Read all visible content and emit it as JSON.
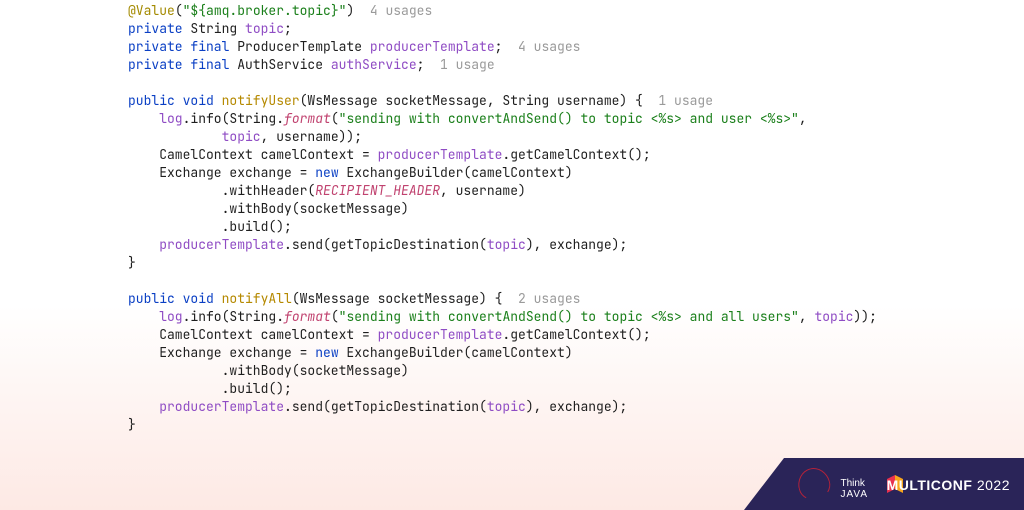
{
  "code": {
    "l1": {
      "ann": "@Value",
      "paren_open": "(",
      "str": "\"${amq.broker.topic}\"",
      "paren_close": ")",
      "hint": "  4 usages"
    },
    "l2": {
      "kw": "private",
      "type": " String ",
      "fld": "topic",
      "semi": ";"
    },
    "l3": {
      "kw": "private final",
      "type": " ProducerTemplate ",
      "fld": "producerTemplate",
      "semi": ";",
      "hint": "  4 usages"
    },
    "l4": {
      "kw": "private final",
      "type": " AuthService ",
      "fld": "authService",
      "semi": ";",
      "hint": "  1 usage"
    },
    "l6": {
      "kw": "public void ",
      "mth": "notifyUser",
      "sig": "(WsMessage socketMessage, String username) {",
      "hint": "  1 usage"
    },
    "l7": {
      "indent": "    ",
      "fld": "log",
      "txt1": ".info(String.",
      "sta": "format",
      "txt2": "(",
      "str": "\"sending with convertAndSend() to topic <%s> and user <%s>\"",
      "txt3": ","
    },
    "l8": {
      "indent": "            ",
      "fld1": "topic",
      "txt1": ", username));"
    },
    "l9": {
      "indent": "    ",
      "txt1": "CamelContext camelContext = ",
      "fld": "producerTemplate",
      "txt2": ".getCamelContext();"
    },
    "l10": {
      "indent": "    ",
      "txt1": "Exchange exchange = ",
      "kw": "new",
      "txt2": " ExchangeBuilder(camelContext)"
    },
    "l11": {
      "indent": "            ",
      "txt1": ".withHeader(",
      "sta": "RECIPIENT_HEADER",
      "txt2": ", username)"
    },
    "l12": {
      "indent": "            ",
      "txt1": ".withBody(socketMessage)"
    },
    "l13": {
      "indent": "            ",
      "txt1": ".build();"
    },
    "l14": {
      "indent": "    ",
      "fld": "producerTemplate",
      "txt1": ".send(getTopicDestination(",
      "fld2": "topic",
      "txt2": "), exchange);"
    },
    "l15": {
      "txt": "}"
    },
    "l17": {
      "kw": "public void ",
      "mth": "notifyAll",
      "sig": "(WsMessage socketMessage) {",
      "hint": "  2 usages"
    },
    "l18": {
      "indent": "    ",
      "fld": "log",
      "txt1": ".info(String.",
      "sta": "format",
      "txt2": "(",
      "str": "\"sending with convertAndSend() to topic <%s> and all users\"",
      "txt3": ", ",
      "fld2": "topic",
      "txt4": "));"
    },
    "l19": {
      "indent": "    ",
      "txt1": "CamelContext camelContext = ",
      "fld": "producerTemplate",
      "txt2": ".getCamelContext();"
    },
    "l20": {
      "indent": "    ",
      "txt1": "Exchange exchange = ",
      "kw": "new",
      "txt2": " ExchangeBuilder(camelContext)"
    },
    "l21": {
      "indent": "            ",
      "txt1": ".withBody(socketMessage)"
    },
    "l22": {
      "indent": "            ",
      "txt1": ".build();"
    },
    "l23": {
      "indent": "    ",
      "fld": "producerTemplate",
      "txt1": ".send(getTopicDestination(",
      "fld2": "topic",
      "txt2": "), exchange);"
    },
    "l24": {
      "txt": "}"
    }
  },
  "banner": {
    "think1": "Think",
    "think2": "JAVA",
    "conf": "MULTICONF",
    "year": " 2022",
    "bg": "#2a2458",
    "accent1": "#e8324f",
    "accent2": "#f7a51c"
  }
}
